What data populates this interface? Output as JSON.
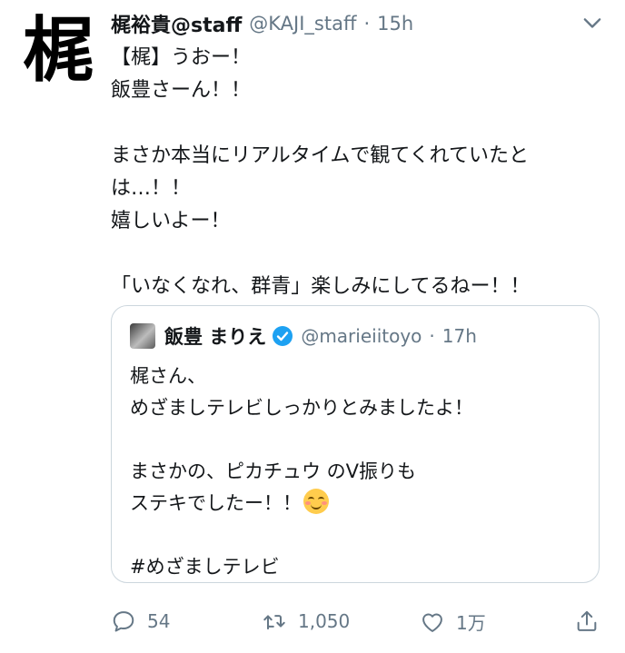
{
  "author": {
    "avatar_char": "梶",
    "name": "梶裕貴@staff",
    "handle": "@KAJI_staff",
    "separator": "·",
    "time": "15h"
  },
  "tweet": {
    "lines": [
      "【梶】うおー！",
      "飯豊さーん！！",
      "",
      "まさか本当にリアルタイムで観てくれていたと",
      "は…！！",
      "嬉しいよー！",
      "",
      "「いなくなれ、群青」楽しみにしてるねー！！"
    ]
  },
  "quoted": {
    "name": "飯豊 まりえ",
    "handle": "@marieiitoyo",
    "separator": "·",
    "time": "17h",
    "lines": [
      "梶さん、",
      "めざましテレビしっかりとみましたよ！",
      "",
      "まさかの、ピカチュウ のV振りも",
      "ステキでしたー！！",
      "",
      "#めざましテレビ"
    ],
    "emoji": "smiling-face-with-smiling-eyes"
  },
  "actions": {
    "replies": "54",
    "retweets": "1,050",
    "likes": "1万"
  },
  "colors": {
    "text": "#14171a",
    "secondary": "#657786",
    "border": "#ccd6dd",
    "verified": "#1da1f2"
  },
  "icons": [
    "chevron-down-icon",
    "verified-icon",
    "reply-icon",
    "retweet-icon",
    "like-icon",
    "share-icon"
  ]
}
